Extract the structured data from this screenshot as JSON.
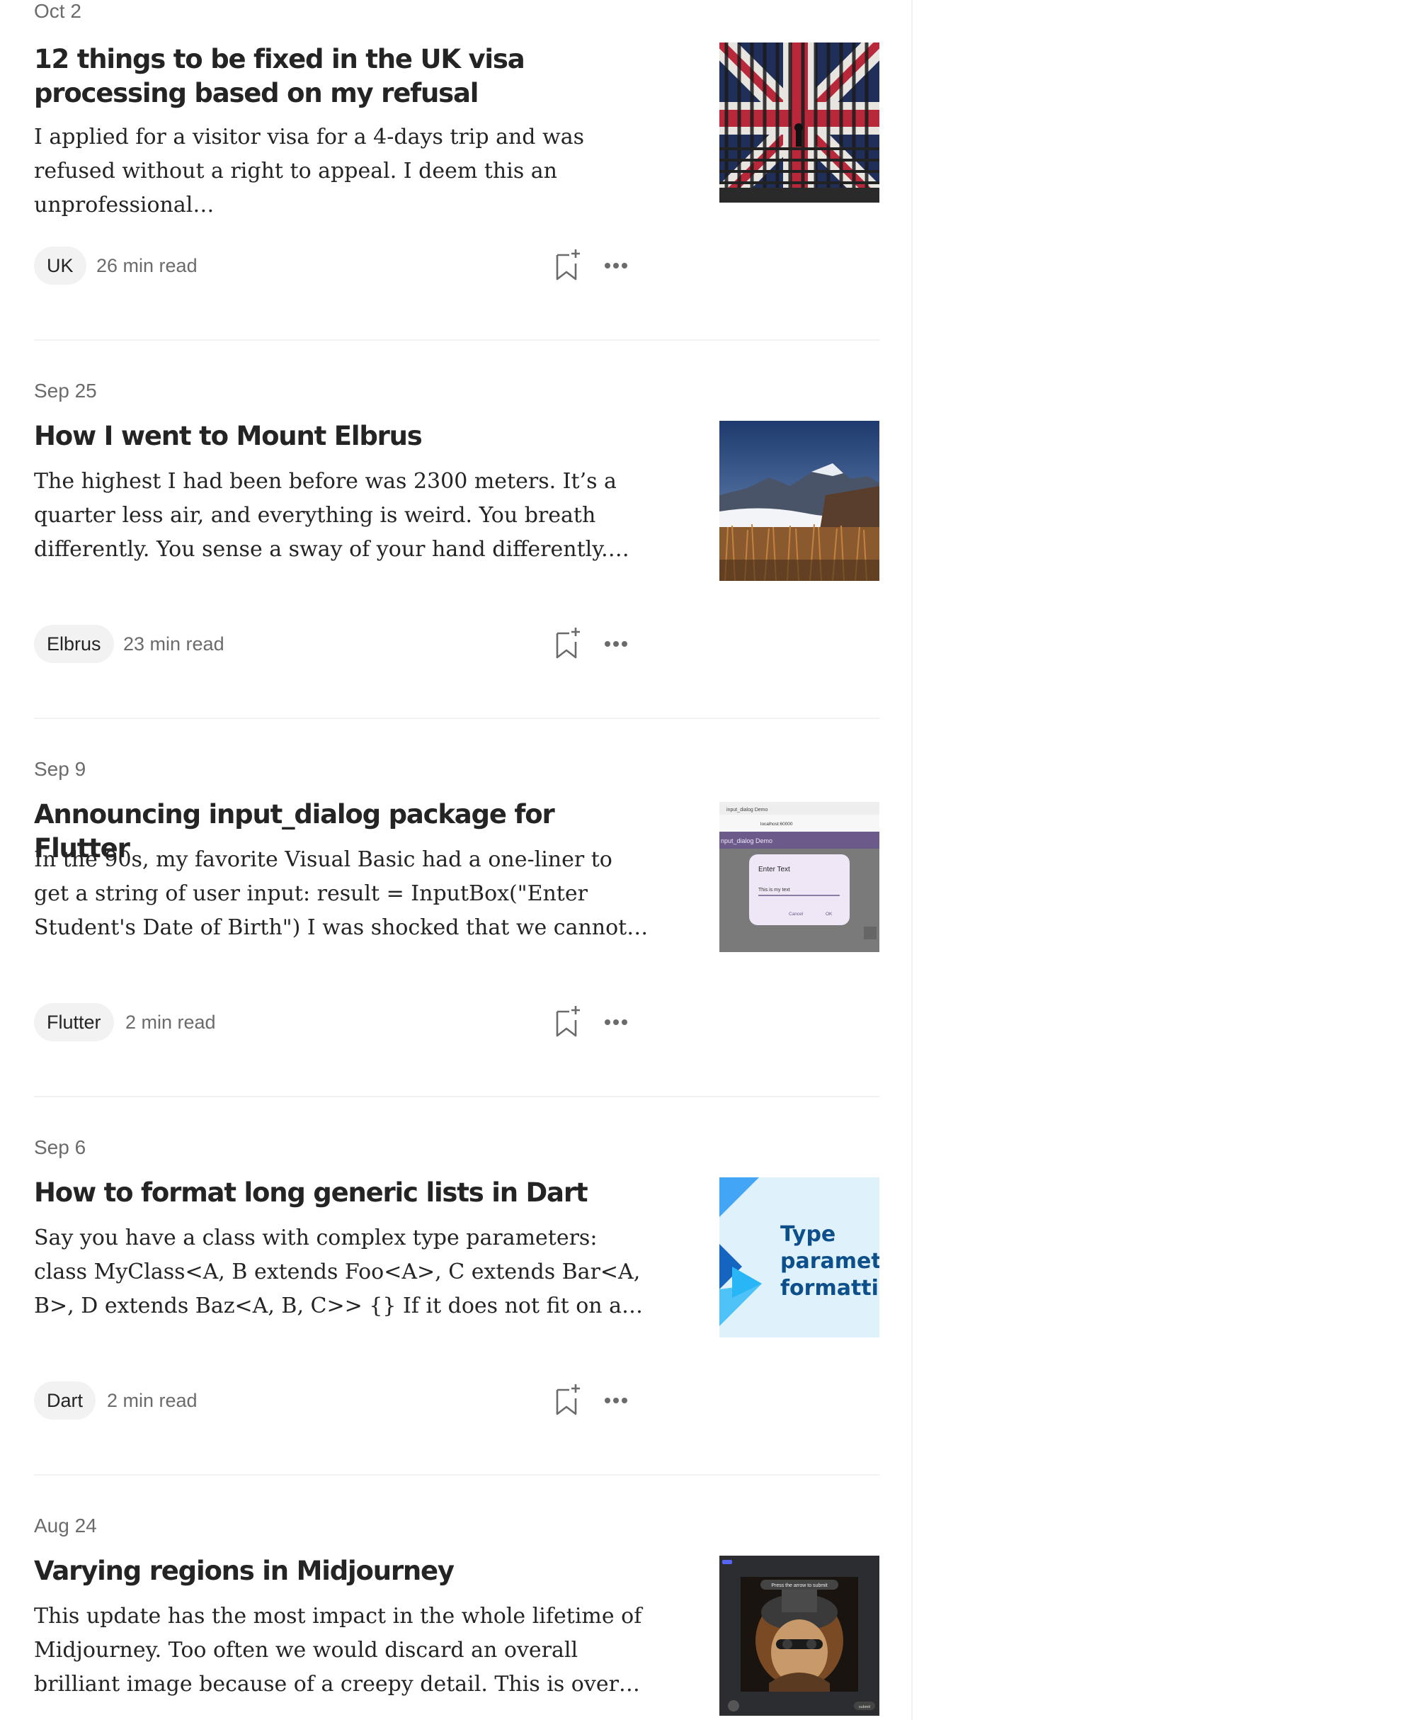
{
  "articles": [
    {
      "date": "Oct 2",
      "title": "12 things to be fixed in the UK visa processing based on my refusal",
      "excerpt": "I applied for a visitor visa for a 4-days trip and was refused without a right to appeal. I deem this an unprofessional…",
      "tag": "UK",
      "read_time": "26 min read",
      "thumb_icon": "uk-flag-gate-image"
    },
    {
      "date": "Sep 25",
      "title": "How I went to Mount Elbrus",
      "excerpt": "The highest I had been before was 2300 meters. It’s a quarter less air, and everything is weird. You breath differently. You sense a sway of your hand differently. It’s…",
      "tag": "Elbrus",
      "read_time": "23 min read",
      "thumb_icon": "mountain-landscape-image"
    },
    {
      "date": "Sep 9",
      "title": "Announcing input_dialog package for Flutter",
      "excerpt": "In the 90s, my favorite Visual Basic had a one-liner to get a string of user input: result = InputBox(\"Enter Student's Date of Birth\") I was shocked that we cannot do this in Flutter.…",
      "tag": "Flutter",
      "read_time": "2 min read",
      "thumb_icon": "input-dialog-screenshot-image",
      "thumb_text": {
        "tab": "input_dialog Demo",
        "url": "localhost:60000",
        "app_title": "nput_dialog Demo",
        "dialog_title": "Enter Text",
        "field_value": "This is my text",
        "cancel": "Cancel",
        "ok": "OK"
      }
    },
    {
      "date": "Sep 6",
      "title": "How to format long generic lists in Dart",
      "excerpt": "Say you have a class with complex type parameters: class MyClass<A, B extends Foo<A>, C extends Bar<A, B>, D extends Baz<A, B, C>> {} If it does not fit on a line, the Da…",
      "tag": "Dart",
      "read_time": "2 min read",
      "thumb_icon": "dart-type-parameter-image",
      "thumb_text": {
        "line1": "Type",
        "line2": "parameter",
        "line3": "formatting"
      }
    },
    {
      "date": "Aug 24",
      "title": "Varying regions in Midjourney",
      "excerpt": "This update has the most impact in the whole lifetime of Midjourney. Too often we would discard an overall brilliant image because of a creepy detail. This is over now with t…",
      "thumb_icon": "midjourney-cat-image",
      "thumb_text": {
        "caption": "Press the arrow to submit",
        "submit": "submit"
      }
    }
  ],
  "colors": {
    "text": "#242424",
    "muted": "#6b6b6b",
    "tag_bg": "#f2f2f2",
    "divider": "#f2f2f2"
  }
}
